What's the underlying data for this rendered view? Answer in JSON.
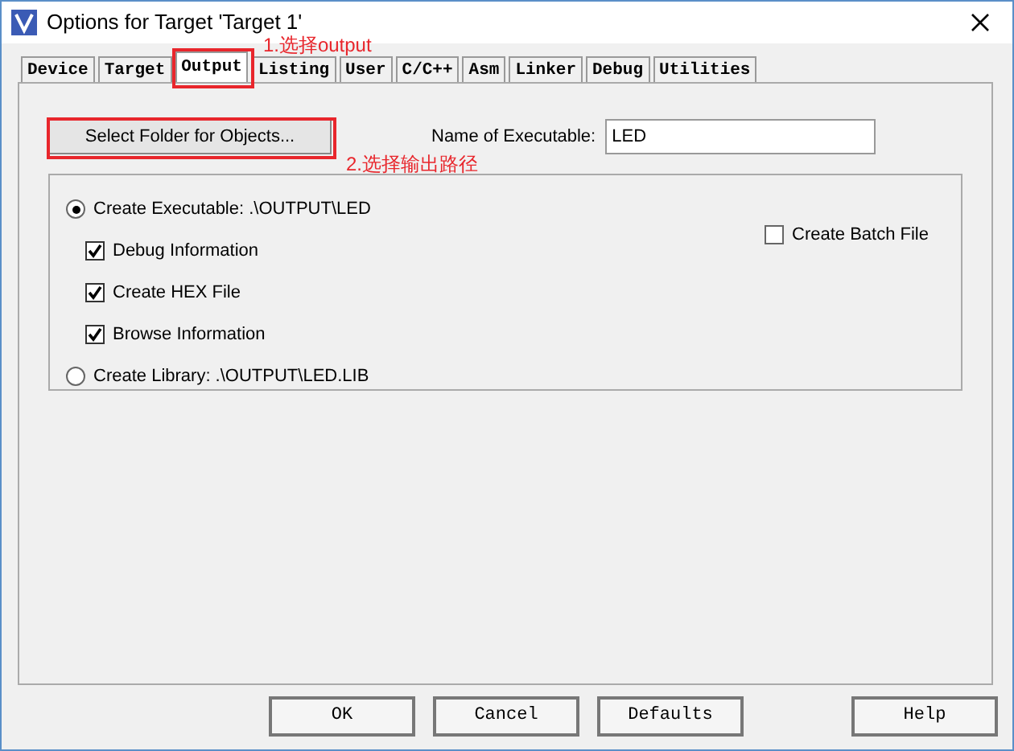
{
  "window": {
    "title": "Options for Target 'Target 1'"
  },
  "tabs": [
    {
      "label": "Device",
      "selected": false
    },
    {
      "label": "Target",
      "selected": false
    },
    {
      "label": "Output",
      "selected": true
    },
    {
      "label": "Listing",
      "selected": false
    },
    {
      "label": "User",
      "selected": false
    },
    {
      "label": "C/C++",
      "selected": false
    },
    {
      "label": "Asm",
      "selected": false
    },
    {
      "label": "Linker",
      "selected": false
    },
    {
      "label": "Debug",
      "selected": false
    },
    {
      "label": "Utilities",
      "selected": false
    }
  ],
  "output": {
    "select_folder_button": "Select Folder for Objects...",
    "name_label": "Name of Executable:",
    "name_value": "LED"
  },
  "options": [
    {
      "kind": "radio",
      "label": "Create Executable:  .\\OUTPUT\\LED",
      "checked": true
    },
    {
      "kind": "checkbox",
      "label": "Debug Information",
      "checked": true
    },
    {
      "kind": "checkbox",
      "label": "Create HEX File",
      "checked": true
    },
    {
      "kind": "checkbox",
      "label": "Browse Information",
      "checked": true
    },
    {
      "kind": "radio",
      "label": "Create Library:  .\\OUTPUT\\LED.LIB",
      "checked": false
    }
  ],
  "batch": {
    "label": "Create Batch File",
    "checked": false
  },
  "buttons": [
    "OK",
    "Cancel",
    "Defaults",
    "Help"
  ],
  "annotations": [
    {
      "text": "1.选择output"
    },
    {
      "text": "2.选择输出路径"
    }
  ]
}
